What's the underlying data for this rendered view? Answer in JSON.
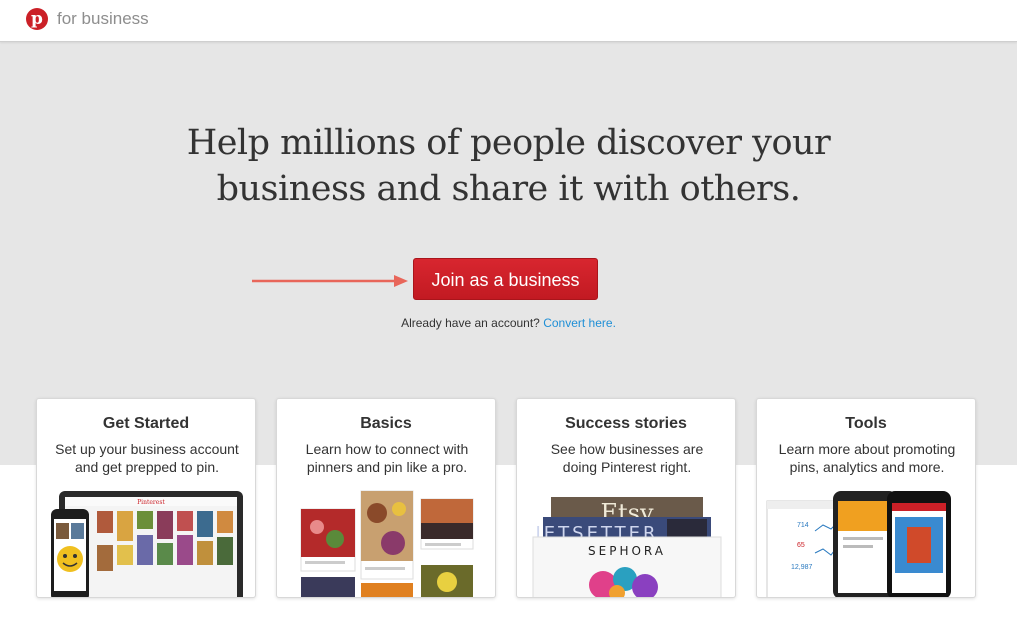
{
  "header": {
    "logo_letter": "p",
    "brand_label": "for business"
  },
  "hero": {
    "headline_line1": "Help millions of people discover your",
    "headline_line2": "business and share it with others.",
    "join_button_label": "Join as a business",
    "account_prompt": "Already have an account?",
    "convert_link": "Convert here."
  },
  "cards": [
    {
      "title": "Get Started",
      "desc_line1": "Set up your business account",
      "desc_line2": "and get prepped to pin."
    },
    {
      "title": "Basics",
      "desc_line1": "Learn how to connect with",
      "desc_line2": "pinners and pin like a pro."
    },
    {
      "title": "Success stories",
      "desc_line1": "See how businesses are",
      "desc_line2": "doing Pinterest right."
    },
    {
      "title": "Tools",
      "desc_line1": "Learn more about promoting",
      "desc_line2": "pins, analytics and more."
    }
  ],
  "card_art": {
    "laptop_brand": "Pinterest",
    "brand_etsy": "Etsy",
    "brand_jetsetter": "JETSETTER",
    "brand_sephora": "SEPHORA",
    "stat_1": "714",
    "stat_2": "65",
    "stat_3": "12,987"
  },
  "colors": {
    "brand_red": "#cb2027",
    "link_blue": "#1f8fd6",
    "hero_bg": "#e6e6e6",
    "arrow": "#e8665a"
  }
}
